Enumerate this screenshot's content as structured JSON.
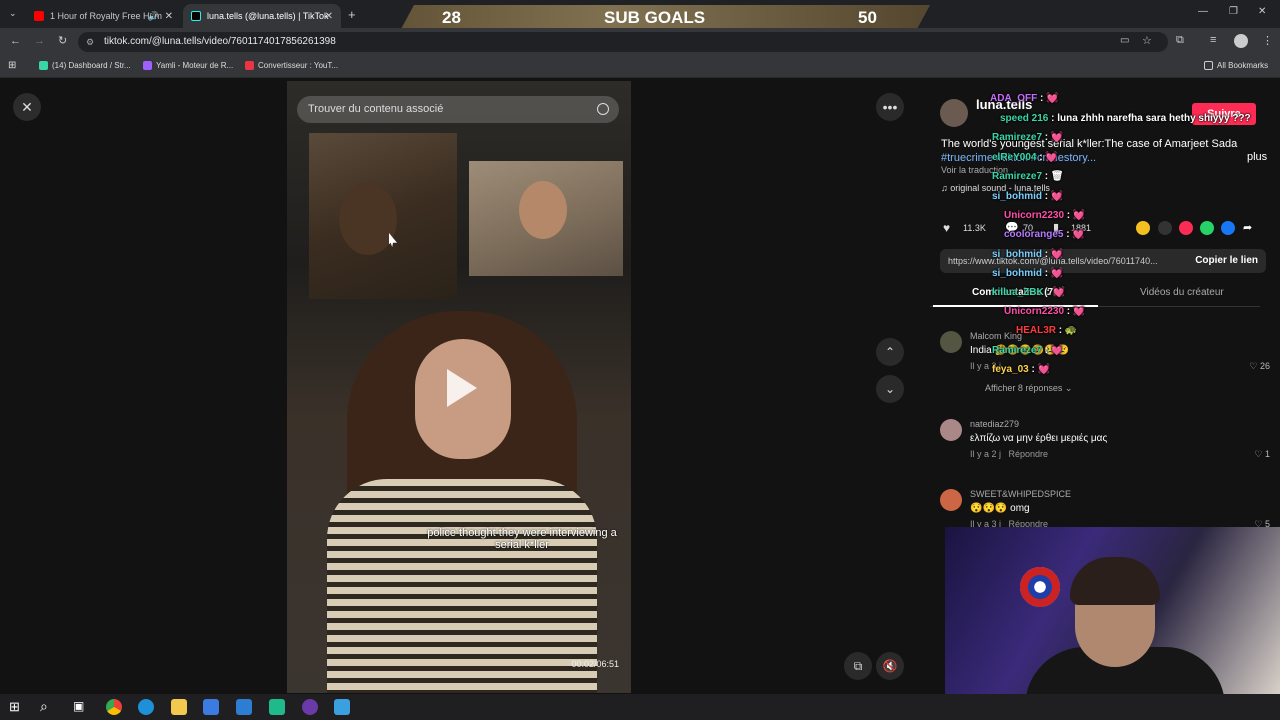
{
  "browser": {
    "tabs": [
      {
        "title": "1 Hour of Royalty Free Hom"
      },
      {
        "title": "luna.tells (@luna.tells) | TikTok"
      }
    ],
    "url": "tiktok.com/@luna.tells/video/7601174017856261398",
    "bookmarks": [
      {
        "label": "(14) Dashboard / Str..."
      },
      {
        "label": "Yamli - Moteur de R..."
      },
      {
        "label": "Convertisseur : YouT..."
      }
    ],
    "all_bookmarks": "All Bookmarks"
  },
  "sub_goals": {
    "current": "28",
    "label": "SUB GOALS",
    "target": "50"
  },
  "video": {
    "search_placeholder": "Trouver du contenu associé",
    "subtitle": "police thought they were interviewing a serial k*ller",
    "time": "00:02/06:51"
  },
  "panel": {
    "creator": "luna.tells",
    "follow": "Suivre",
    "description": "The world's youngest serial k*ller:The case of Amarjeet Sada",
    "hashtags": "#truecrime #tiktok #crimestory...",
    "more": "plus",
    "translate": "Voir la traduction",
    "sound": "original sound - luna.tells",
    "likes": "11.3K",
    "comments_count": "70",
    "saves": "1881",
    "link": "https://www.tiktok.com/@luna.tells/video/76011740...",
    "copy_link": "Copier le lien",
    "tab_comments": "Commentaires (70)",
    "tab_creator_videos": "Vidéos du créateur",
    "comments": [
      {
        "user": "Malcom King",
        "text": "India 🤔😢😢😢😢😢",
        "meta": "Il y a 3 j",
        "likes": "26"
      },
      {
        "user": "natediaz279",
        "text": "ελπίζω να μην έρθει μεριές μας",
        "meta": "Il y a 2 j",
        "reply": "Répondre",
        "likes": "1"
      },
      {
        "user": "SWEET&WHIPEDSPICE",
        "text": "😯😯😯 omg",
        "meta": "Il y a 3 j",
        "reply": "Répondre",
        "likes": "5"
      }
    ],
    "show_replies": "Afficher 8 réponses"
  },
  "chat": [
    {
      "user": "ADA_OFF",
      "color": "#c86cff",
      "text": "💓"
    },
    {
      "user": "speed 216",
      "color": "#3ad6a8",
      "text": "luna zhhh narefha sara hethy shiyyy ???"
    },
    {
      "user": "Ramireze7",
      "color": "#3ad6a8",
      "text": "💓"
    },
    {
      "user": "elReY004",
      "color": "#3ad6a8",
      "text": "💓"
    },
    {
      "user": "Ramireze7",
      "color": "#3ad6a8",
      "text": "🗑"
    },
    {
      "user": "si_bohmid",
      "color": "#7ad0ff",
      "text": "💓"
    },
    {
      "user": "Unicorn2230",
      "color": "#ff4fa8",
      "text": "💓"
    },
    {
      "user": "coolorange5",
      "color": "#b87aff",
      "text": "💓"
    },
    {
      "user": "si_bohmid",
      "color": "#7ad0ff",
      "text": "💓"
    },
    {
      "user": "si_bohmid",
      "color": "#7ad0ff",
      "text": "💓"
    },
    {
      "user": "killua_ZBK",
      "color": "#3ad6a8",
      "text": "💓"
    },
    {
      "user": "Unicorn2230",
      "color": "#ff4fa8",
      "text": "💓"
    },
    {
      "user": "HEAL3R",
      "color": "#ff3a3a",
      "text": "🐢"
    },
    {
      "user": "Ramireze7",
      "color": "#3ad6a8",
      "text": "💓"
    },
    {
      "user": "feya_03",
      "color": "#ffd34a",
      "text": "💓"
    }
  ]
}
